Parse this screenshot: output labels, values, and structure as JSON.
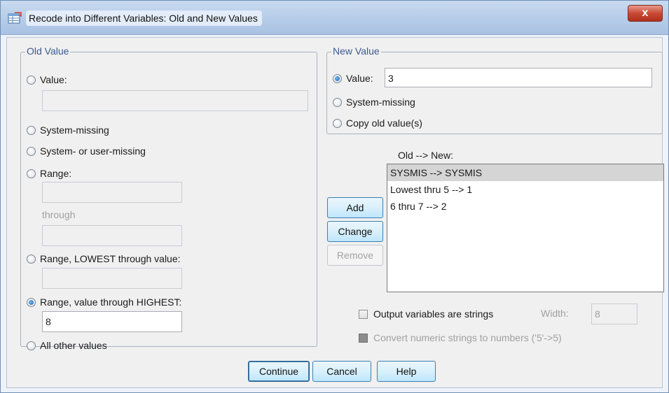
{
  "window": {
    "title": "Recode into Different Variables: Old and New Values",
    "close_symbol": "x"
  },
  "old_value": {
    "legend": "Old Value",
    "value_label": "Value:",
    "value_input": "",
    "system_missing_label": "System-missing",
    "system_user_missing_label": "System- or user-missing",
    "range_label": "Range:",
    "range_from": "",
    "through_label": "through",
    "range_to": "",
    "lowest_label": "Range, LOWEST through value:",
    "lowest_input": "",
    "highest_label": "Range, value through HIGHEST:",
    "highest_input": "8",
    "all_other_label": "All other values",
    "selected": "range_highest"
  },
  "new_value": {
    "legend": "New Value",
    "value_label": "Value:",
    "value_input": "3",
    "system_missing_label": "System-missing",
    "copy_label": "Copy old value(s)",
    "selected": "value"
  },
  "mapping": {
    "header": "Old --> New:",
    "items": [
      "SYSMIS --> SYSMIS",
      "Lowest thru 5 --> 1",
      "6 thru 7 --> 2"
    ],
    "selected_index": 0
  },
  "actions": {
    "add": "Add",
    "change": "Change",
    "remove": "Remove"
  },
  "options": {
    "output_strings_label": "Output variables are strings",
    "width_label": "Width:",
    "width_value": "8",
    "convert_label": "Convert numeric strings to numbers ('5'->5)"
  },
  "footer": {
    "continue": "Continue",
    "cancel": "Cancel",
    "help": "Help"
  },
  "colors": {
    "accent": "#3c7fb1",
    "legend_text": "#3a5b8f"
  }
}
